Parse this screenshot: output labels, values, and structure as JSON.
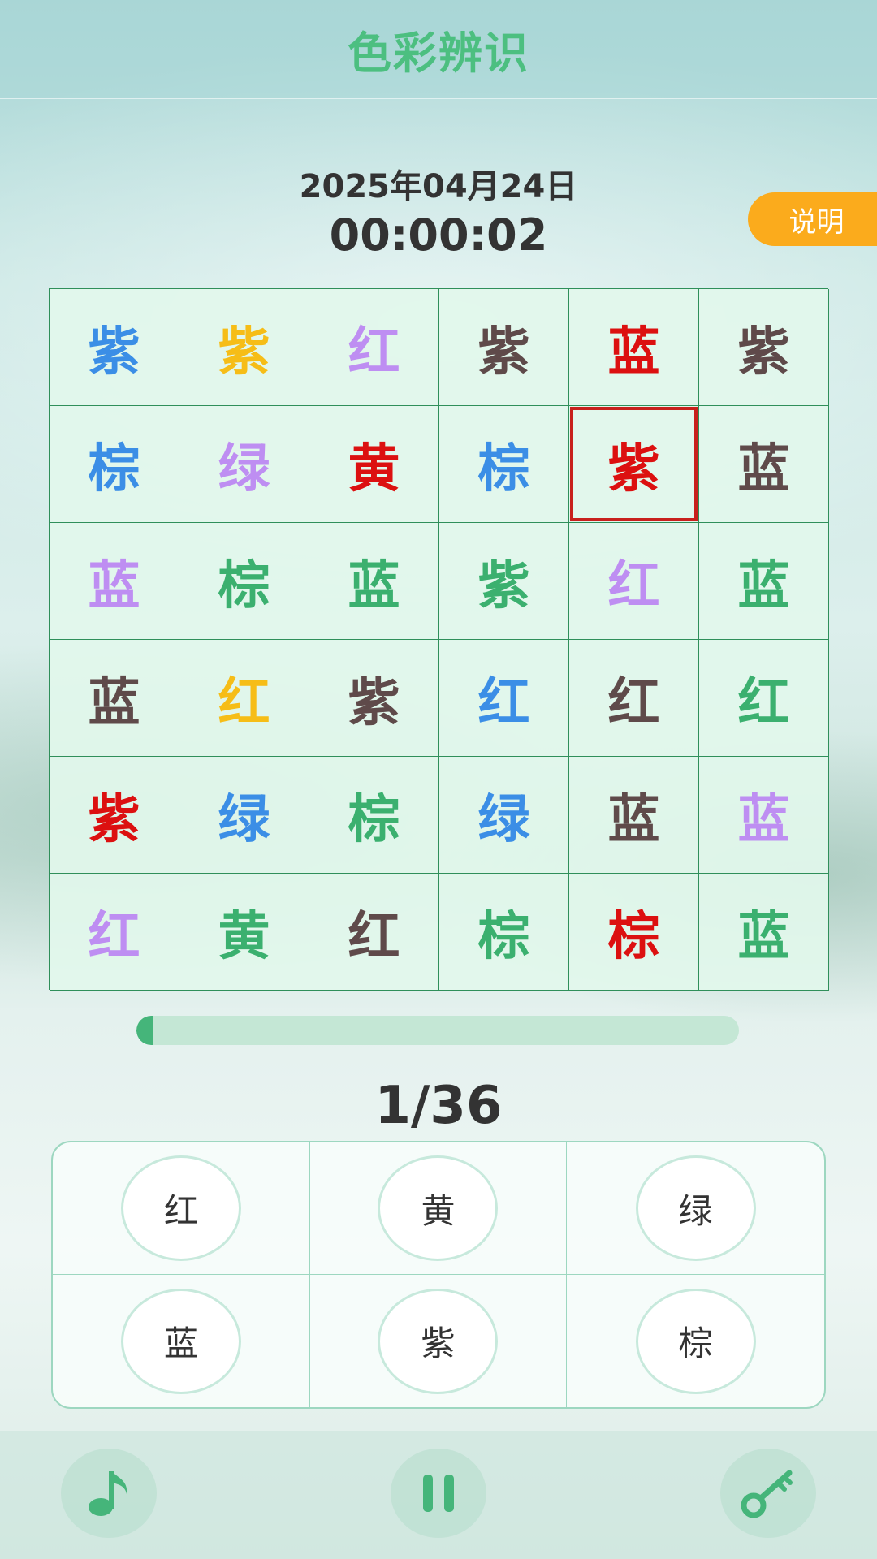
{
  "header": {
    "title": "色彩辨识"
  },
  "status": {
    "date": "2025年04月24日",
    "timer": "00:00:02"
  },
  "help_button_label": "说明",
  "colors": {
    "blue": "#3b8ee6",
    "yellow": "#f6bd17",
    "purple": "#be8ef2",
    "brown": "#5f4a4a",
    "red": "#dc1010",
    "green": "#3bb06f"
  },
  "grid": {
    "selected_index": 10,
    "cells": [
      {
        "char": "紫",
        "color": "blue"
      },
      {
        "char": "紫",
        "color": "yellow"
      },
      {
        "char": "红",
        "color": "purple"
      },
      {
        "char": "紫",
        "color": "brown"
      },
      {
        "char": "蓝",
        "color": "red"
      },
      {
        "char": "紫",
        "color": "brown"
      },
      {
        "char": "棕",
        "color": "blue"
      },
      {
        "char": "绿",
        "color": "purple"
      },
      {
        "char": "黄",
        "color": "red"
      },
      {
        "char": "棕",
        "color": "blue"
      },
      {
        "char": "紫",
        "color": "red"
      },
      {
        "char": "蓝",
        "color": "brown"
      },
      {
        "char": "蓝",
        "color": "purple"
      },
      {
        "char": "棕",
        "color": "green"
      },
      {
        "char": "蓝",
        "color": "green"
      },
      {
        "char": "紫",
        "color": "green"
      },
      {
        "char": "红",
        "color": "purple"
      },
      {
        "char": "蓝",
        "color": "green"
      },
      {
        "char": "蓝",
        "color": "brown"
      },
      {
        "char": "红",
        "color": "yellow"
      },
      {
        "char": "紫",
        "color": "brown"
      },
      {
        "char": "红",
        "color": "blue"
      },
      {
        "char": "红",
        "color": "brown"
      },
      {
        "char": "红",
        "color": "green"
      },
      {
        "char": "紫",
        "color": "red"
      },
      {
        "char": "绿",
        "color": "blue"
      },
      {
        "char": "棕",
        "color": "green"
      },
      {
        "char": "绿",
        "color": "blue"
      },
      {
        "char": "蓝",
        "color": "brown"
      },
      {
        "char": "蓝",
        "color": "purple"
      },
      {
        "char": "红",
        "color": "purple"
      },
      {
        "char": "黄",
        "color": "green"
      },
      {
        "char": "红",
        "color": "brown"
      },
      {
        "char": "棕",
        "color": "green"
      },
      {
        "char": "棕",
        "color": "red"
      },
      {
        "char": "蓝",
        "color": "green"
      }
    ]
  },
  "progress": {
    "label": "1/36",
    "fraction": 0.0278
  },
  "answers": [
    "红",
    "黄",
    "绿",
    "蓝",
    "紫",
    "棕"
  ],
  "bottom_bar": {
    "icons": [
      "music-note-icon",
      "pause-icon",
      "key-icon"
    ]
  }
}
